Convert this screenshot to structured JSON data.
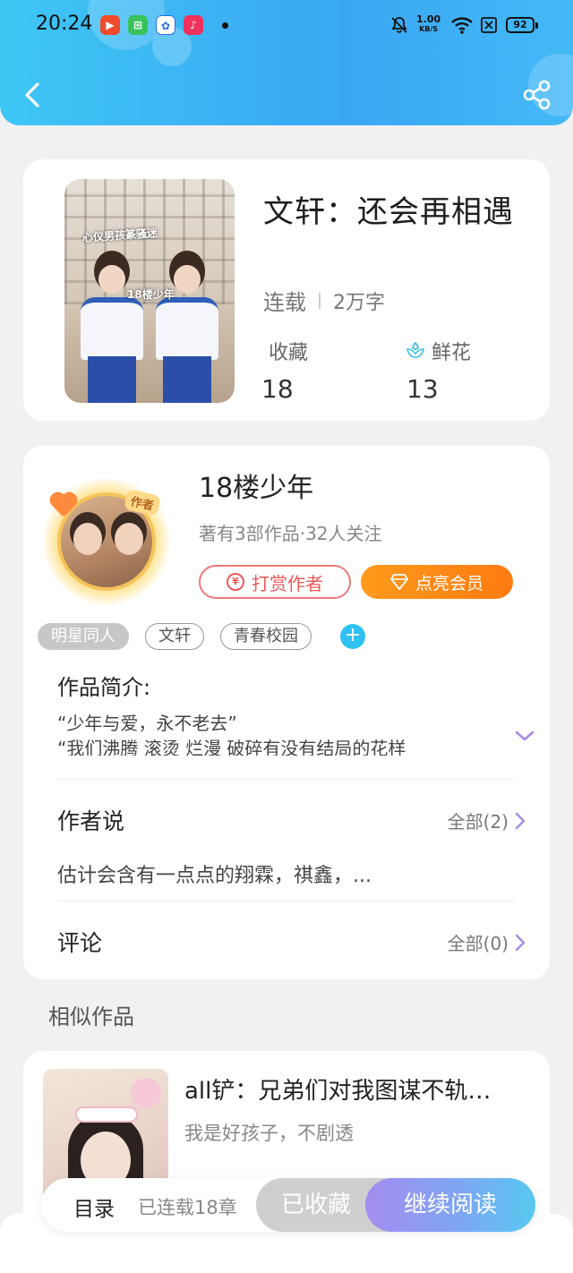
{
  "status_bar": {
    "time": "20:24",
    "net_speed_value": "1.00",
    "net_speed_unit": "KB/S",
    "battery": "92"
  },
  "book": {
    "title": "文轩：还会再相遇",
    "status": "连载",
    "word_count": "2万字",
    "favorites_label": "收藏",
    "favorites_count": "18",
    "flowers_label": "鲜花",
    "flowers_count": "13",
    "cover_caption_top": "心仪男孩篆骚迷",
    "cover_caption_mid": "18楼少年"
  },
  "author": {
    "name": "18楼少年",
    "info": "著有3部作品·32人关注",
    "avatar_tag": "作者",
    "reward_label": "打赏作者",
    "reward_icon": "¥",
    "vip_label": "点亮会员"
  },
  "tags": [
    "明星同人",
    "文轩",
    "青春校园"
  ],
  "intro": {
    "title": "作品简介:",
    "line1": "“少年与爱，永不老去”",
    "line2": "“我们沸腾 滚烫 烂漫 破碎有没有结局的花样"
  },
  "author_says": {
    "title": "作者说",
    "more": "全部(2)",
    "text": "估计会含有一点点的翔霖，祺鑫，..."
  },
  "comments": {
    "title": "评论",
    "more": "全部(0)"
  },
  "similar": {
    "heading": "相似作品",
    "items": [
      {
        "title": "all铲：兄弟们对我图谋不轨…",
        "desc": "我是好孩子，不剧透"
      }
    ]
  },
  "bottom": {
    "toc_label": "目录",
    "chapters": "已连载18章",
    "collected_label": "已收藏",
    "continue_label": "继续阅读"
  },
  "colors": {
    "header_accent": "#3aa7f3",
    "vip_orange": "#ff8a16",
    "reward_red": "#ea5a5a",
    "link_purple": "#a78be8"
  }
}
